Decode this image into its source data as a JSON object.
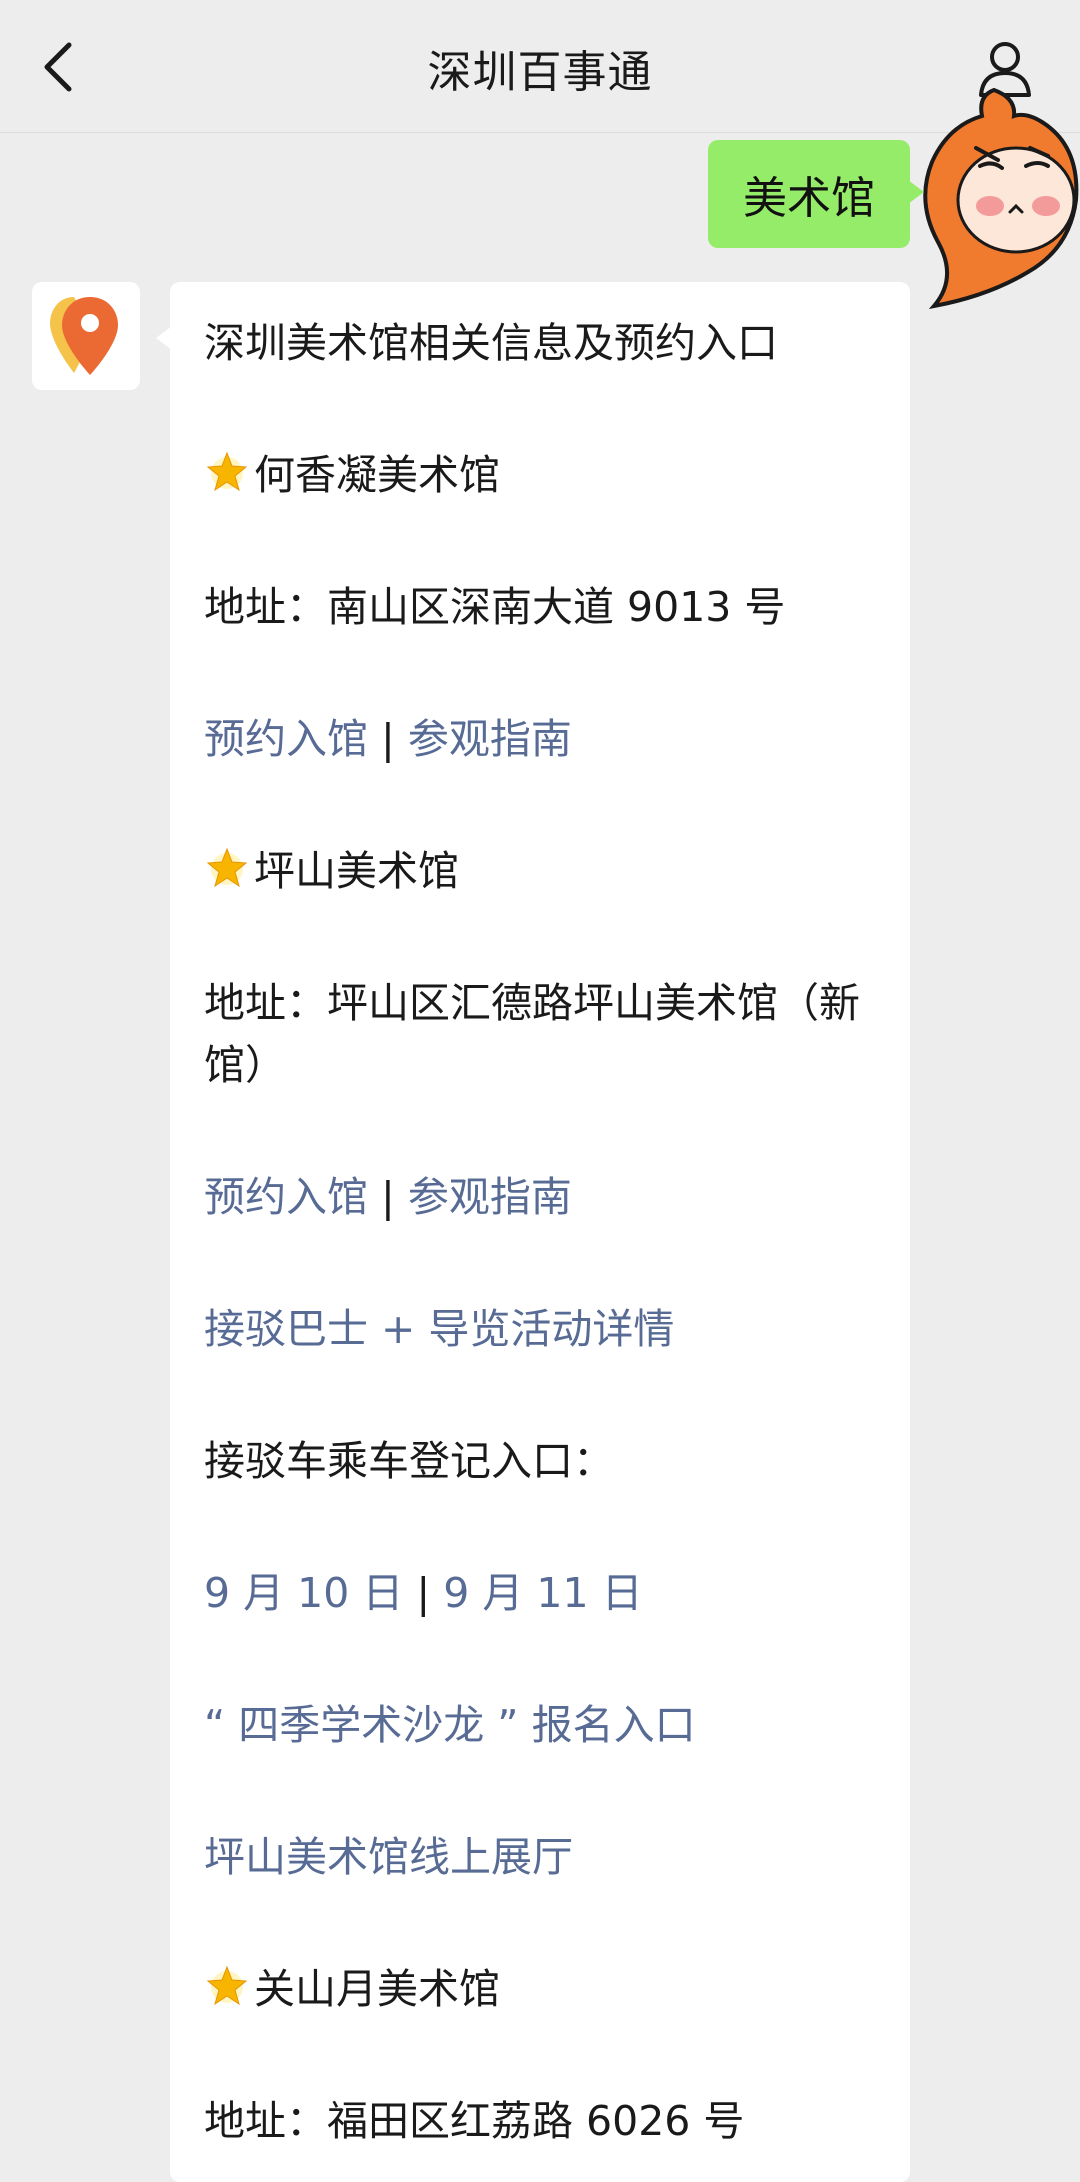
{
  "header": {
    "title": "深圳百事通",
    "back_icon": "chevron-left-icon",
    "profile_icon": "person-icon"
  },
  "user_message": {
    "text": "美术馆"
  },
  "bot_message": {
    "intro": "深圳美术馆相关信息及预约入口",
    "museum1": {
      "name": "何香凝美术馆",
      "address": "地址：南山区深南大道 9013 号",
      "link_booking": "预约入馆",
      "separator": "|",
      "link_guide": "参观指南"
    },
    "museum2": {
      "name": "坪山美术馆",
      "address": "地址：坪山区汇德路坪山美术馆（新馆）",
      "link_booking": "预约入馆",
      "separator": "|",
      "link_guide": "参观指南",
      "link_shuttle": "接驳巴士 + 导览活动详情",
      "shuttle_register": "接驳车乘车登记入口：",
      "link_date1": "9 月 10 日",
      "date_separator": "|",
      "link_date2": "9 月 11 日",
      "link_salon": "“ 四季学术沙龙 ” 报名入口",
      "link_online": "坪山美术馆线上展厅"
    },
    "museum3": {
      "name": "关山月美术馆",
      "address": "地址：福田区红荔路 6026 号"
    }
  },
  "colors": {
    "link": "#576b95",
    "user_bubble": "#95ec69",
    "background": "#ededed"
  }
}
